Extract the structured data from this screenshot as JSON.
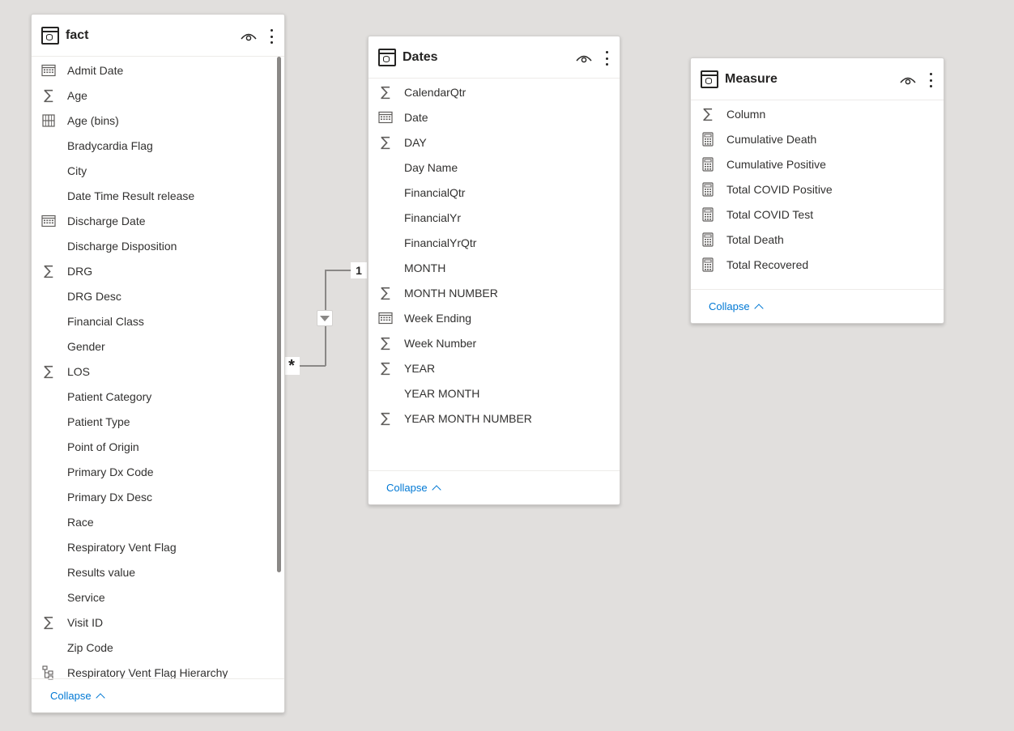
{
  "tables": {
    "fact": {
      "title": "fact",
      "fields": [
        {
          "name": "Admit Date",
          "icon": "calendar-icon"
        },
        {
          "name": "Age",
          "icon": "sigma-icon"
        },
        {
          "name": "Age (bins)",
          "icon": "bins-icon"
        },
        {
          "name": "Bradycardia Flag",
          "icon": ""
        },
        {
          "name": "City",
          "icon": ""
        },
        {
          "name": "Date Time Result release",
          "icon": ""
        },
        {
          "name": "Discharge Date",
          "icon": "calendar-icon"
        },
        {
          "name": "Discharge Disposition",
          "icon": ""
        },
        {
          "name": "DRG",
          "icon": "sigma-icon"
        },
        {
          "name": "DRG Desc",
          "icon": ""
        },
        {
          "name": "Financial Class",
          "icon": ""
        },
        {
          "name": "Gender",
          "icon": ""
        },
        {
          "name": "LOS",
          "icon": "sigma-icon"
        },
        {
          "name": "Patient Category",
          "icon": ""
        },
        {
          "name": "Patient Type",
          "icon": ""
        },
        {
          "name": "Point of Origin",
          "icon": ""
        },
        {
          "name": "Primary Dx Code",
          "icon": ""
        },
        {
          "name": "Primary Dx Desc",
          "icon": ""
        },
        {
          "name": "Race",
          "icon": ""
        },
        {
          "name": "Respiratory Vent Flag",
          "icon": ""
        },
        {
          "name": "Results value",
          "icon": ""
        },
        {
          "name": "Service",
          "icon": ""
        },
        {
          "name": "Visit ID",
          "icon": "sigma-icon"
        },
        {
          "name": "Zip Code",
          "icon": ""
        },
        {
          "name": "Respiratory Vent Flag Hierarchy",
          "icon": "hierarchy-icon"
        }
      ],
      "collapse_label": "Collapse"
    },
    "dates": {
      "title": "Dates",
      "fields": [
        {
          "name": "CalendarQtr",
          "icon": "sigma-icon"
        },
        {
          "name": "Date",
          "icon": "calendar-icon"
        },
        {
          "name": "DAY",
          "icon": "sigma-icon"
        },
        {
          "name": "Day Name",
          "icon": ""
        },
        {
          "name": "FinancialQtr",
          "icon": ""
        },
        {
          "name": "FinancialYr",
          "icon": ""
        },
        {
          "name": "FinancialYrQtr",
          "icon": ""
        },
        {
          "name": "MONTH",
          "icon": ""
        },
        {
          "name": "MONTH NUMBER",
          "icon": "sigma-icon"
        },
        {
          "name": "Week Ending",
          "icon": "calendar-icon"
        },
        {
          "name": "Week Number",
          "icon": "sigma-icon"
        },
        {
          "name": "YEAR",
          "icon": "sigma-icon"
        },
        {
          "name": "YEAR MONTH",
          "icon": ""
        },
        {
          "name": "YEAR MONTH NUMBER",
          "icon": "sigma-icon"
        }
      ],
      "collapse_label": "Collapse"
    },
    "measure": {
      "title": "Measure",
      "fields": [
        {
          "name": "Column",
          "icon": "sigma-icon"
        },
        {
          "name": "Cumulative Death",
          "icon": "calculator-icon"
        },
        {
          "name": "Cumulative Positive",
          "icon": "calculator-icon"
        },
        {
          "name": "Total COVID Positive",
          "icon": "calculator-icon"
        },
        {
          "name": "Total COVID Test",
          "icon": "calculator-icon"
        },
        {
          "name": "Total Death",
          "icon": "calculator-icon"
        },
        {
          "name": "Total Recovered",
          "icon": "calculator-icon"
        }
      ],
      "collapse_label": "Collapse"
    }
  },
  "relationship": {
    "one_side": "1",
    "many_side": "*",
    "filter_direction_icon": "triangle-down-icon"
  },
  "colors": {
    "canvas": "#e1dfdd",
    "accent_link": "#0078d4",
    "text": "#252423",
    "line": "#8a8886"
  }
}
